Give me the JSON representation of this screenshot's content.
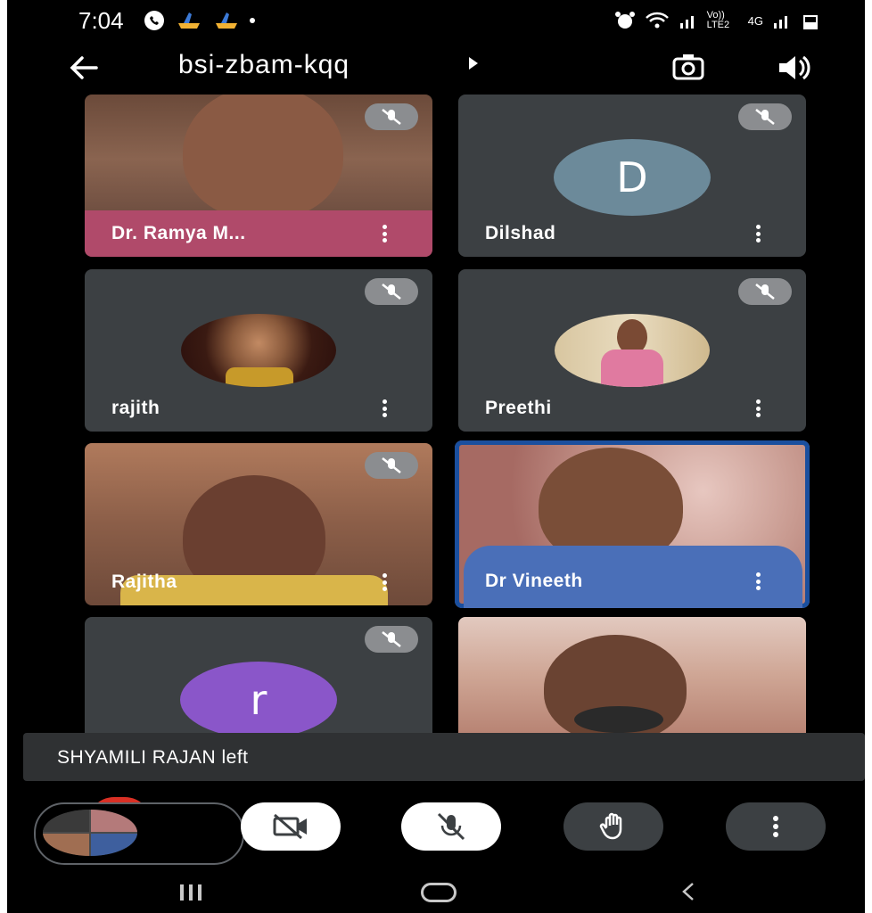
{
  "status_bar": {
    "time": "7:04",
    "icons_left": [
      "call-icon",
      "app-icon",
      "app-icon",
      "dot-icon"
    ],
    "icons_right": [
      "alarm-icon",
      "wifi-icon",
      "signal-icon",
      "volte-icon",
      "4g-icon",
      "signal-icon",
      "battery-icon"
    ],
    "net_label_1": "Vo)) LTE2",
    "net_label_2": "4G"
  },
  "header": {
    "meeting_code": "bsi-zbam-kqq",
    "back_icon": "back-arrow-icon",
    "flip_icon": "switch-camera-icon",
    "speaker_icon": "speaker-icon"
  },
  "participants": [
    {
      "name": "Dr. Ramya M...",
      "type": "video",
      "muted": true
    },
    {
      "name": "Dilshad",
      "type": "letter",
      "letter": "D",
      "avatar_color": "#6c8a9a",
      "muted": true
    },
    {
      "name": "rajith",
      "type": "photo",
      "muted": true
    },
    {
      "name": "Preethi",
      "type": "photo",
      "muted": true
    },
    {
      "name": "Rajitha",
      "type": "video",
      "muted": true
    },
    {
      "name": "Dr Vineeth",
      "type": "video",
      "muted": false,
      "active_speaker": true
    },
    {
      "name": "",
      "type": "letter",
      "letter": "r",
      "avatar_color": "#8a56c9",
      "muted": true
    },
    {
      "name": "",
      "type": "video",
      "muted": false
    }
  ],
  "toast": {
    "message": "SHYAMILI RAJAN left"
  },
  "controls": {
    "camera_icon": "camera-off-icon",
    "mic_icon": "mic-off-icon",
    "hand_icon": "raise-hand-icon",
    "more_icon": "more-options-icon"
  },
  "nav_bar": {
    "recent_icon": "recent-apps-icon",
    "home_icon": "home-icon",
    "back_icon": "nav-back-icon"
  },
  "colors": {
    "tile_bg": "#3c4043",
    "active_border": "#1a4f9e",
    "mute_badge": "#8b8d90",
    "leave_red": "#d93025"
  }
}
